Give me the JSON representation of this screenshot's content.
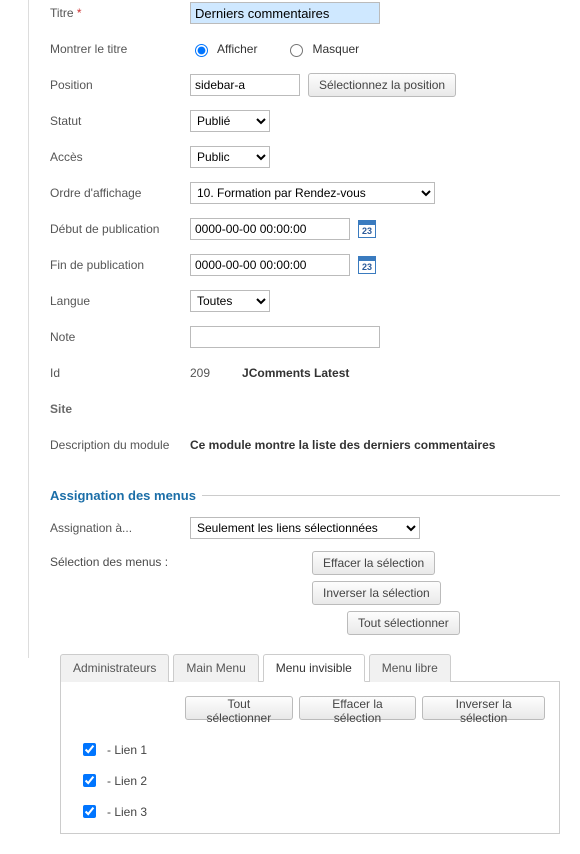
{
  "labels": {
    "title": "Titre",
    "show_title": "Montrer le titre",
    "position": "Position",
    "status": "Statut",
    "access": "Accès",
    "ordering": "Ordre d'affichage",
    "publish_up": "Début de publication",
    "publish_down": "Fin de publication",
    "language": "Langue",
    "note": "Note",
    "id": "Id",
    "site": "Site",
    "module_desc": "Description du module"
  },
  "title": "Derniers commentaires",
  "show_title": {
    "show": "Afficher",
    "hide": "Masquer"
  },
  "position": {
    "value": "sidebar-a",
    "button": "Sélectionnez la position"
  },
  "status": {
    "value": "Publié"
  },
  "access": {
    "value": "Public"
  },
  "ordering": {
    "value": "10. Formation par Rendez-vous"
  },
  "publish_up": "0000-00-00 00:00:00",
  "publish_down": "0000-00-00 00:00:00",
  "language": {
    "value": "Toutes"
  },
  "note": "",
  "id_value": "209",
  "module_type": "JComments Latest",
  "module_desc": "Ce module montre la liste des derniers commentaires",
  "cal_day": "23",
  "menu_assign": {
    "legend": "Assignation des menus",
    "assign_to_label": "Assignation à...",
    "assign_to_value": "Seulement les liens sélectionnées",
    "selection_label": "Sélection des menus :",
    "btn_clear": "Effacer la sélection",
    "btn_invert": "Inverser la sélection",
    "btn_select_all": "Tout sélectionner",
    "tabs": {
      "admin": "Administrateurs",
      "main": "Main Menu",
      "invisible": "Menu invisible",
      "free": "Menu libre"
    },
    "panel_btns": {
      "select_all": "Tout sélectionner",
      "clear": "Effacer la sélection",
      "invert": "Inverser la sélection"
    },
    "links": {
      "l1": "- Lien 1",
      "l2": "- Lien 2",
      "l3": "- Lien 3"
    }
  }
}
